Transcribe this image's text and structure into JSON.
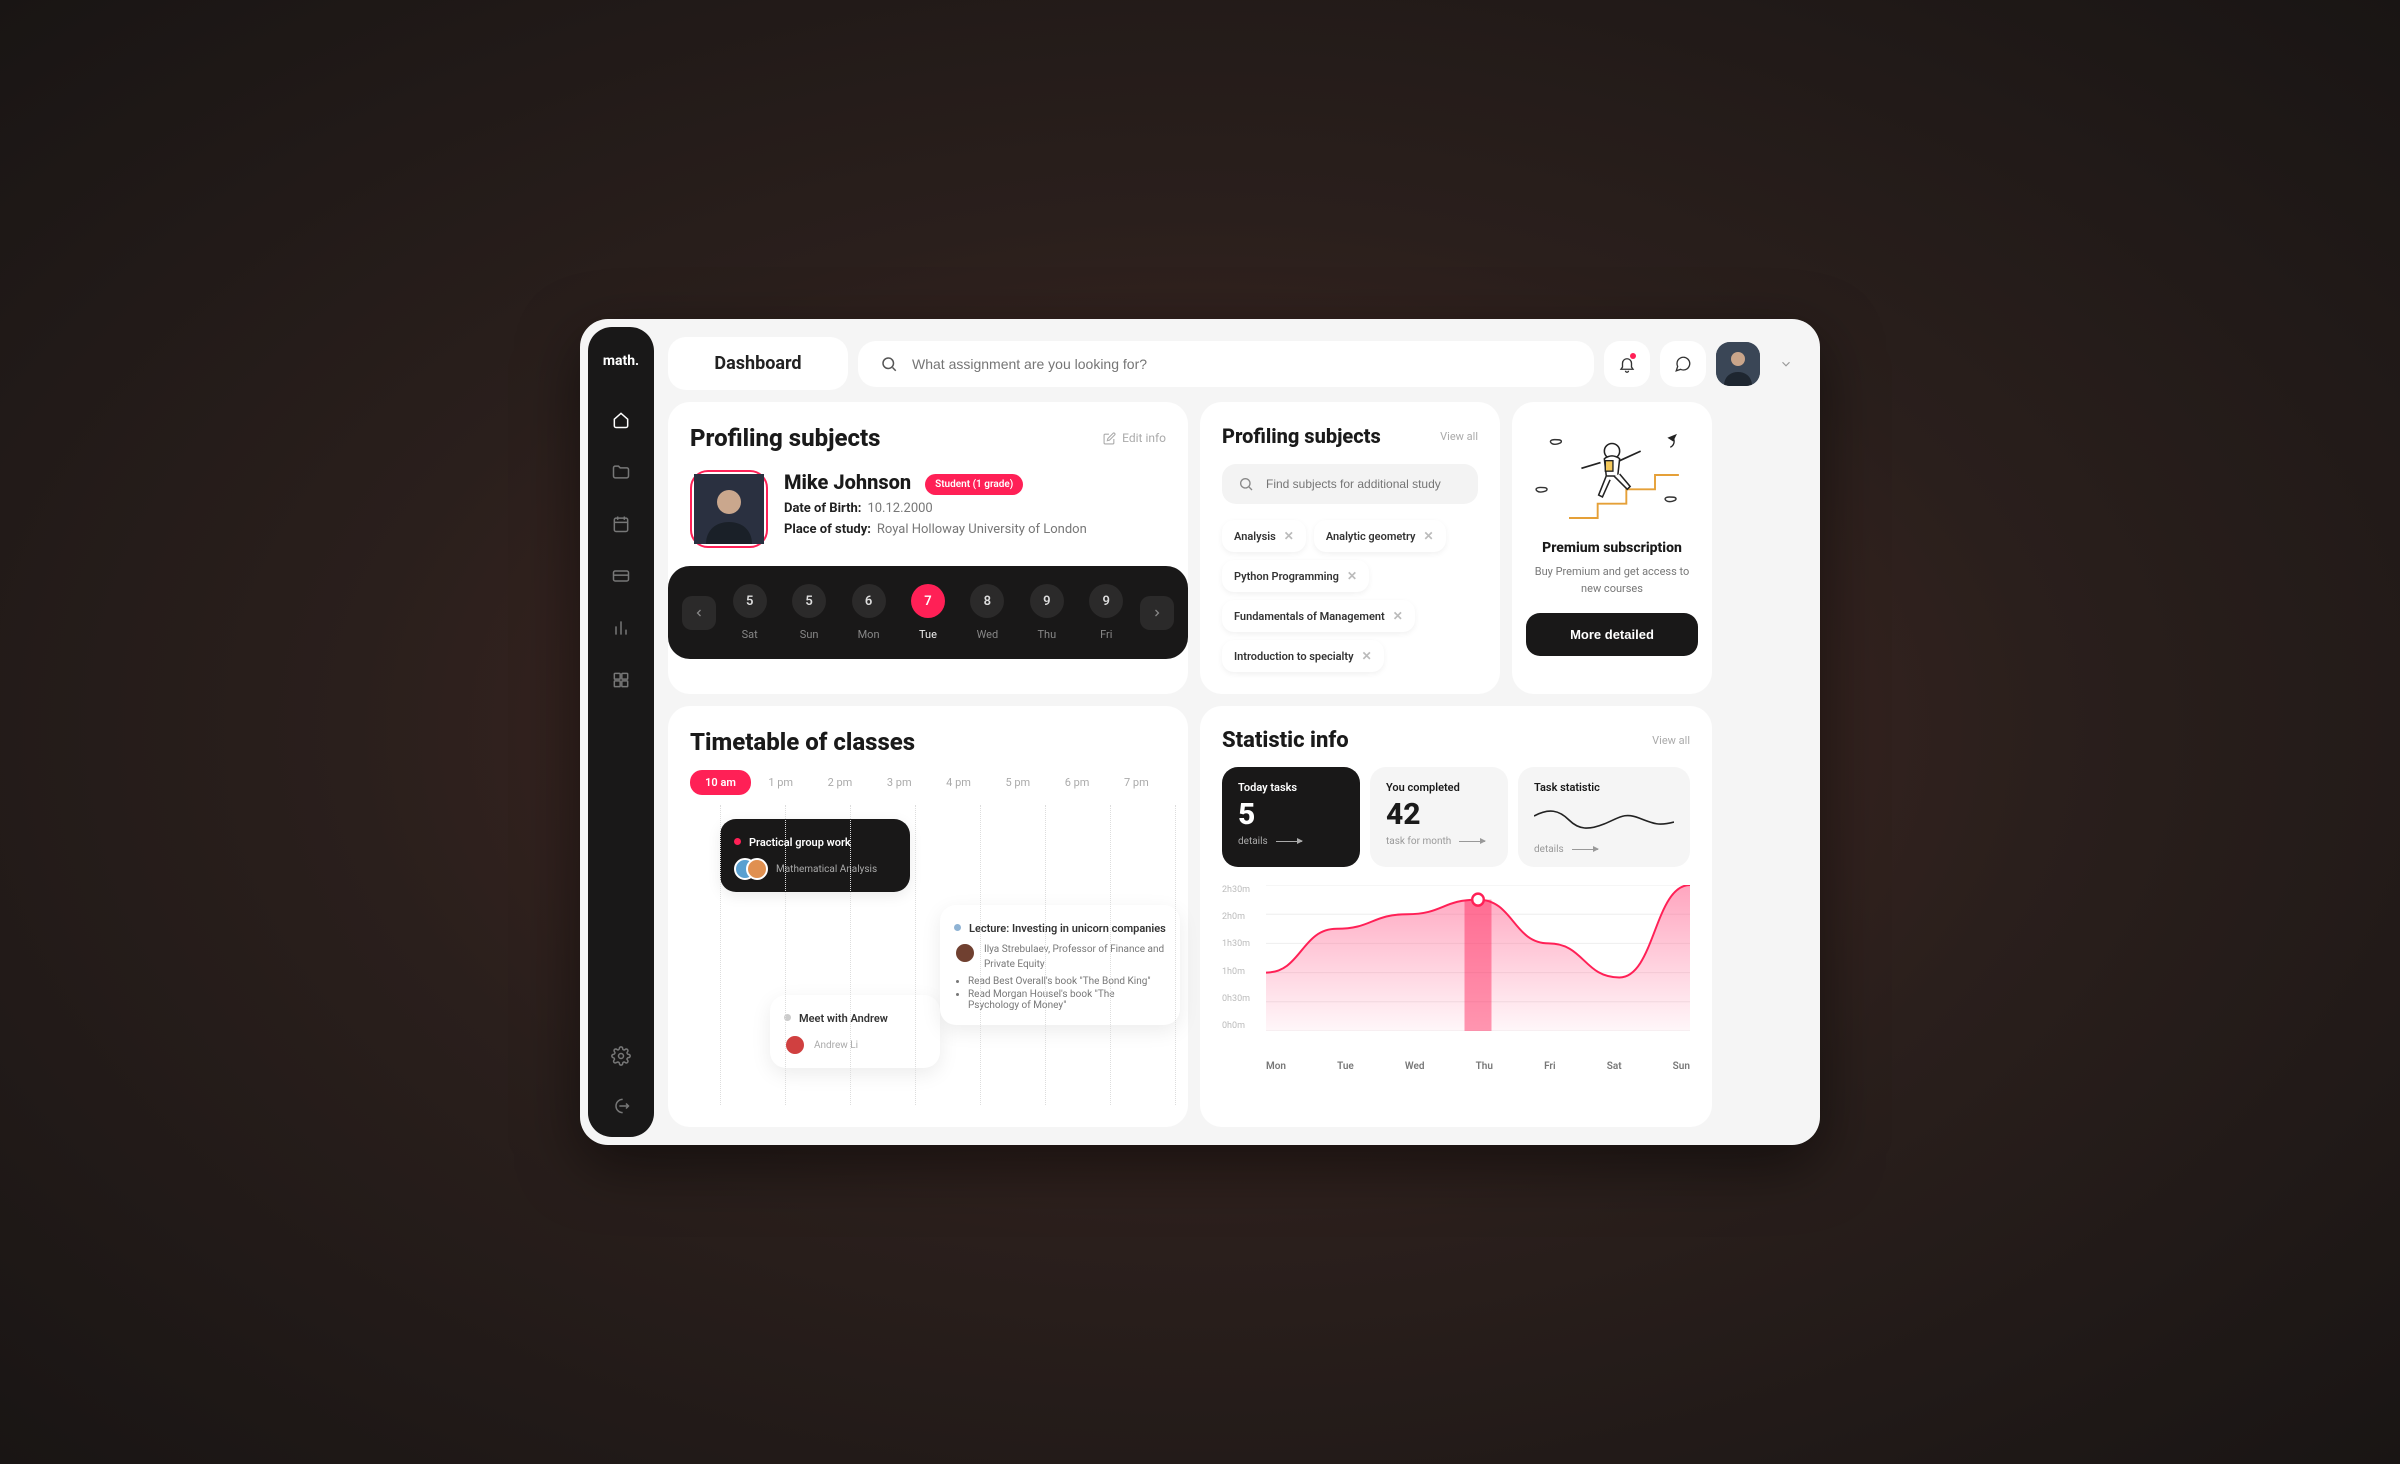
{
  "brand": "math.",
  "header": {
    "page_title": "Dashboard",
    "search_placeholder": "What assignment are you looking for?"
  },
  "profile": {
    "section_title": "Profiling subjects",
    "edit_label": "Edit info",
    "name": "Mike Johnson",
    "badge": "Student (1 grade)",
    "dob_label": "Date of Birth:",
    "dob_value": "10.12.2000",
    "study_label": "Place of study:",
    "study_value": "Royal Holloway University of London"
  },
  "week": {
    "days": [
      {
        "num": "5",
        "label": "Sat"
      },
      {
        "num": "5",
        "label": "Sun"
      },
      {
        "num": "6",
        "label": "Mon"
      },
      {
        "num": "7",
        "label": "Tue",
        "active": true
      },
      {
        "num": "8",
        "label": "Wed"
      },
      {
        "num": "9",
        "label": "Thu"
      },
      {
        "num": "9",
        "label": "Fri"
      }
    ]
  },
  "subjects": {
    "section_title": "Profiling subjects",
    "view_all": "View all",
    "search_placeholder": "Find subjects for additional study",
    "tags": [
      "Analysis",
      "Analytic geometry",
      "Python Programming",
      "Fundamentals of Management",
      "Introduction to specialty"
    ]
  },
  "premium": {
    "title": "Premium subscription",
    "body": "Buy Premium and get access to new courses",
    "cta": "More detailed"
  },
  "timetable": {
    "section_title": "Timetable of classes",
    "hours": [
      "10 am",
      "1 pm",
      "2 pm",
      "3 pm",
      "4 pm",
      "5 pm",
      "6 pm",
      "7 pm"
    ],
    "events": {
      "practical": {
        "title": "Practical group work",
        "sub": "Mathematical Analysis",
        "dot": "#ff2056"
      },
      "meet": {
        "title": "Meet with Andrew",
        "person": "Andrew Li",
        "dot": "#ccc"
      },
      "lecture": {
        "title": "Lecture: Investing in unicorn companies",
        "presenter": "Ilya Strebulaev, Professor of Finance and Private Equity",
        "bullets": [
          "Read Best Overall's book \"The Bond King\"",
          "Read Morgan Housel's book \"The Psychology of Money\""
        ],
        "dot": "#aad"
      }
    }
  },
  "stats": {
    "section_title": "Statistic info",
    "view_all": "View all",
    "tiles": {
      "today": {
        "title": "Today tasks",
        "value": "5",
        "foot": "details"
      },
      "completed": {
        "title": "You completed",
        "value": "42",
        "foot": "task for month"
      },
      "tstat": {
        "title": "Task statistic",
        "foot": "details"
      }
    },
    "chart_data": {
      "type": "area",
      "title": "",
      "xlabel": "",
      "ylabel": "",
      "y_ticks": [
        "2h30m",
        "2h0m",
        "1h30m",
        "1h0m",
        "0h30m",
        "0h0m"
      ],
      "categories": [
        "Mon",
        "Tue",
        "Wed",
        "Thu",
        "Fri",
        "Sat",
        "Sun"
      ],
      "values_minutes": [
        60,
        105,
        120,
        135,
        90,
        55,
        150
      ],
      "highlight_index": 3,
      "ylim_minutes": [
        0,
        150
      ]
    }
  }
}
